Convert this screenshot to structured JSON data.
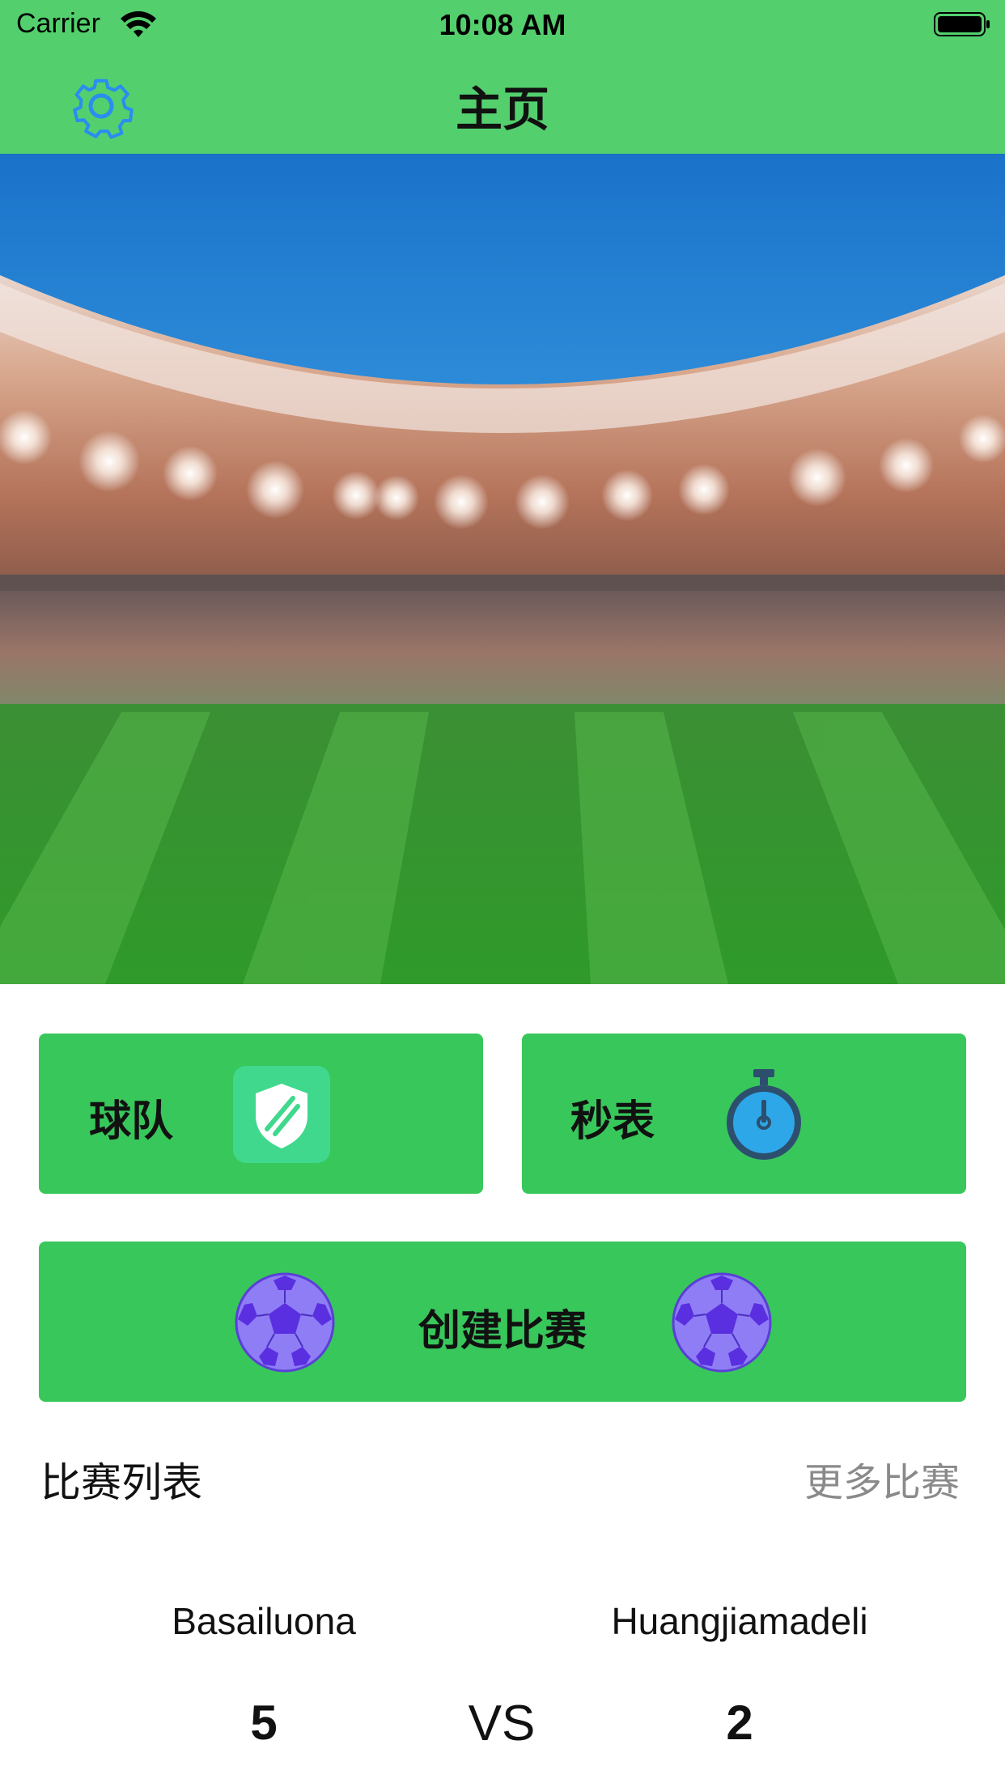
{
  "status_bar": {
    "carrier": "Carrier",
    "time": "10:08 AM",
    "icons": [
      "wifi-icon",
      "battery-icon"
    ]
  },
  "nav": {
    "title": "主页",
    "settings_icon": "gear-icon"
  },
  "hero": {
    "image": "stadium-photo"
  },
  "actions": {
    "team": {
      "label": "球队",
      "icon": "shield-icon"
    },
    "timer": {
      "label": "秒表",
      "icon": "stopwatch-icon"
    },
    "create_match": {
      "label": "创建比赛",
      "icon": "soccer-ball-icon"
    }
  },
  "match_list": {
    "title": "比赛列表",
    "more_label": "更多比赛",
    "items": [
      {
        "team_a": "Basailuona",
        "team_b": "Huangjiamadeli",
        "score_a": "5",
        "score_b": "2",
        "vs_label": "VS"
      }
    ]
  },
  "colors": {
    "nav_bg": "#53d06d",
    "button_bg": "#38c75b",
    "accent_blue": "#2a8df0",
    "ball_purple": "#7a5cf0",
    "more_gray": "#8a8a8a"
  }
}
